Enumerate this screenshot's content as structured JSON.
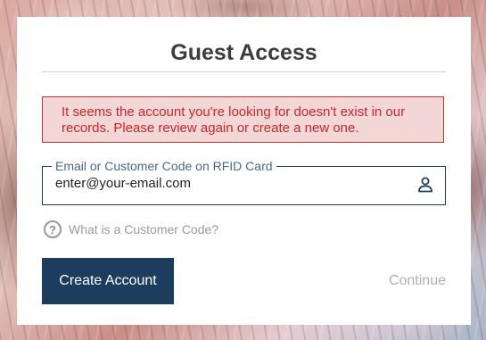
{
  "dialog": {
    "title": "Guest Access",
    "error_message": "It seems the account you're looking for doesn't exist in our records. Please review again or create a new one."
  },
  "email_field": {
    "label": "Email or Customer Code on RFID Card",
    "placeholder": "enter@your-email.com",
    "icon": "user-icon"
  },
  "help": {
    "icon": "question-circle-icon",
    "text": "What is a Customer Code?"
  },
  "actions": {
    "create_label": "Create Account",
    "continue_label": "Continue"
  },
  "colors": {
    "primary": "#1c3d5e",
    "error_text": "#c62828",
    "error_bg": "#f3d6d6",
    "error_border": "#c0392b"
  }
}
